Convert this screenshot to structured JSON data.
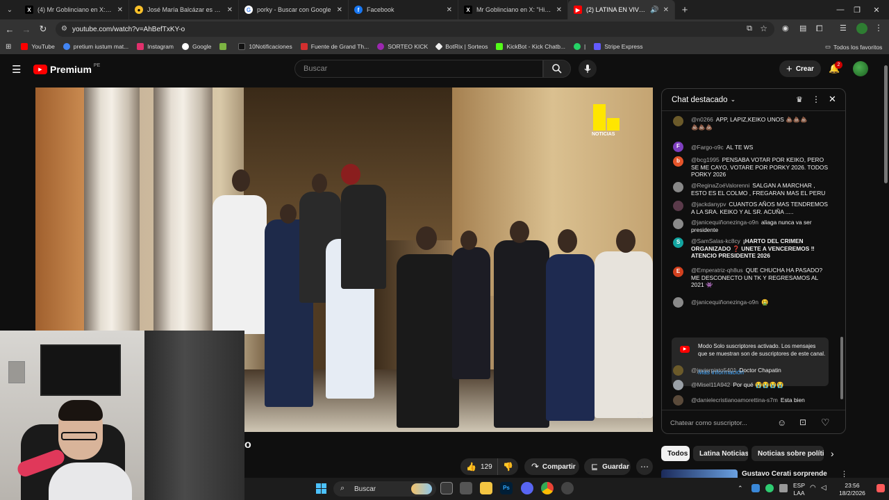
{
  "browser": {
    "tabs": [
      {
        "label": "(4) Mr Goblinciano en X: \"Hicie",
        "icon": "x-logo-icon",
        "active": false
      },
      {
        "label": "José María Balcázar es el nuevo",
        "icon": "news-favicon-icon",
        "active": false
      },
      {
        "label": "porky - Buscar con Google",
        "icon": "google-icon",
        "active": false
      },
      {
        "label": "Facebook",
        "icon": "facebook-icon",
        "active": false
      },
      {
        "label": "Mr Goblinciano en X: \"Hicieron",
        "icon": "x-logo-icon",
        "active": false
      },
      {
        "label": "(2) LATINA EN VIVO: NOTIC",
        "icon": "youtube-icon",
        "active": true
      }
    ],
    "url": "youtube.com/watch?v=AhBefTxKY-o",
    "bookmarks": [
      {
        "label": "YouTube",
        "color": "#ff0000"
      },
      {
        "label": "pretium iustum mat...",
        "color": "#4285f4"
      },
      {
        "label": "Instagram",
        "color": "#e1306c"
      },
      {
        "label": "Google",
        "color": "#4285f4"
      },
      {
        "label": "",
        "color": "#7cb342"
      },
      {
        "label": "10Notificaciones",
        "color": "#111111"
      },
      {
        "label": "Fuente de Grand Th...",
        "color": "#d32f2f"
      },
      {
        "label": "SORTEO KICK",
        "color": "#9c27b0"
      },
      {
        "label": "BotRix | Sorteos",
        "color": "#eeeeee"
      },
      {
        "label": "KickBot - Kick Chatb...",
        "color": "#53fc18"
      },
      {
        "label": "|",
        "color": "#25d366"
      },
      {
        "label": "Stripe Express",
        "color": "#635bff"
      }
    ],
    "all_bookmarks": "Todos los favoritos"
  },
  "youtube": {
    "brand": "Premium",
    "region": "PE",
    "search_placeholder": "Buscar",
    "create_label": "Crear",
    "notif_count": "2",
    "video_title_fragment": "o",
    "like_count": "129",
    "share_label": "Compartir",
    "save_label": "Guardar",
    "channel_logo_text": "NOTICIAS"
  },
  "chat": {
    "title": "Chat destacado",
    "messages": [
      {
        "author": "@n0266",
        "text": "APP, LAPIZ,KEIKO UNOS 💩💩💩",
        "extra": "💩💩💩",
        "avatar_color": "#6b5a2a",
        "initial": ""
      },
      {
        "author": "@Fargo-o9c",
        "text": "AL TE WS",
        "avatar_color": "#7e3fbf",
        "initial": "F"
      },
      {
        "author": "@bcg1995",
        "text": "PENSABA VOTAR POR KEIKO, PERO SE ME CAYO, VOTARE POR PORKY 2026. TODOS PORKY 2026",
        "avatar_color": "#e5542a",
        "initial": "b"
      },
      {
        "author": "@ReginaZoéValorenni",
        "text": "SALGAN A MARCHAR , ESTO ES EL COLMO , FREGARAN MAS EL PERU",
        "avatar_color": "#888888",
        "initial": ""
      },
      {
        "author": "@jackdanypv",
        "text": "CUANTOS AÑOS MAS TENDREMOS A LA SRA. KEIKO Y AL SR. ACUÑA .....",
        "avatar_color": "#5a3a4a",
        "initial": ""
      },
      {
        "author": "@janicequiñonezinga-o9n",
        "text": "aliaga nunca va ser presidente",
        "avatar_color": "#8a8a8a",
        "initial": ""
      },
      {
        "author": "@SamSalas-kc8cy",
        "text": "¡HARTO DEL CRIMEN ORGANIZADO ❓ UNETE A VENCEREMOS ‼ ATENCIO PRESIDENTE 2026",
        "avatar_color": "#12a4a0",
        "initial": "S"
      },
      {
        "author": "@Emperatriz-qh8us",
        "text": "QUE CHUCHA HA PASADO? ME DESCONECTO UN TK Y REGRESAMOS AL 2021 👾",
        "avatar_color": "#d2401e",
        "initial": "E"
      },
      {
        "author": "@janicequiñonezinga-o9n",
        "text": "🤮",
        "avatar_color": "#8a8a8a",
        "initial": ""
      },
      {
        "author": "@javierpinto5401",
        "text": "Doctor Chapatin",
        "avatar_color": "#6b5a2a",
        "initial": ""
      },
      {
        "author": "@Misel11A942",
        "text": "Por qué 😭😭😭😭",
        "avatar_color": "#9aa0a6",
        "initial": ""
      },
      {
        "author": "@danielecristianoamorettina-s7m",
        "text": "Esta bien",
        "avatar_color": "#5a4a3a",
        "initial": ""
      }
    ],
    "notice_text": "Modo Solo suscriptores activado. Los mensajes que se muestran son de suscriptores de este canal.",
    "notice_link": "Más información",
    "input_placeholder": "Chatear como suscriptor..."
  },
  "chips": [
    "Todos",
    "Latina Noticias",
    "Noticias sobre polític"
  ],
  "related": {
    "title": "Gustavo Cerati sorprende"
  },
  "taskbar": {
    "search_label": "Buscar",
    "lang": "ESP",
    "lang2": "LAA",
    "time": "23:56",
    "date": "18/2/2026"
  }
}
